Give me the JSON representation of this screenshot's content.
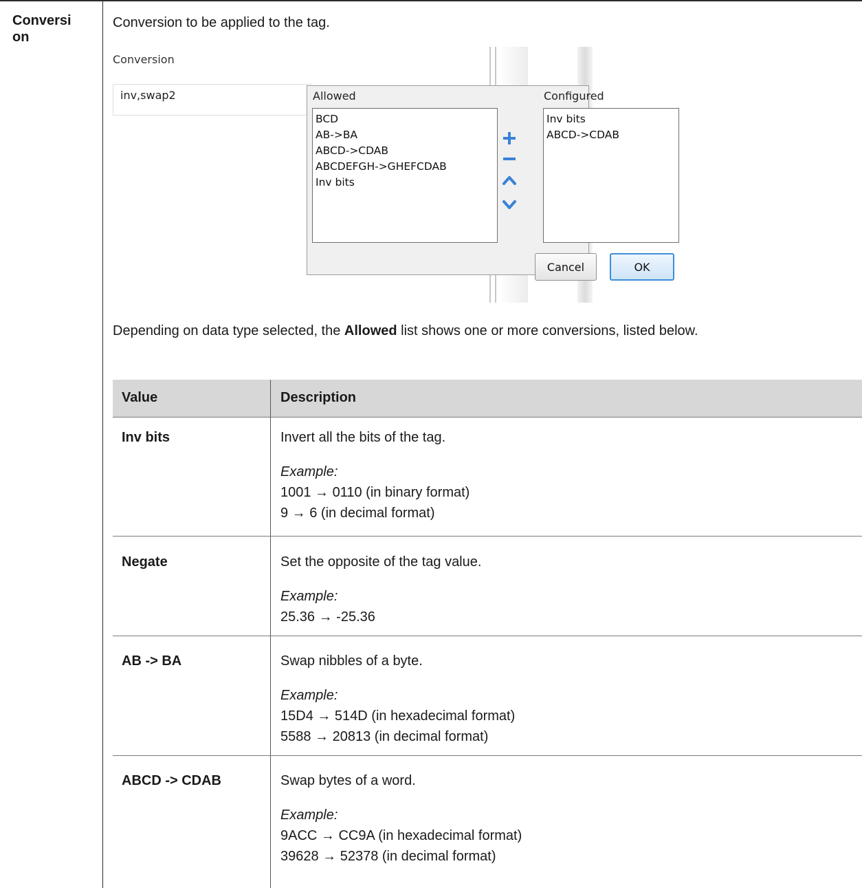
{
  "term": "Conversion",
  "term_line1": "Conversi",
  "term_line2": "on",
  "intro": "Conversion to be applied to the tag.",
  "screenshot": {
    "field_label": "Conversion",
    "field_value": "inv,swap2",
    "allowed_title": "Allowed",
    "configured_title": "Configured",
    "allowed_items": [
      "BCD",
      "AB->BA",
      "ABCD->CDAB",
      "ABCDEFGH->GHEFCDAB",
      "Inv bits"
    ],
    "configured_items": [
      "Inv bits",
      "ABCD->CDAB"
    ],
    "add_icon": "plus-icon",
    "remove_icon": "minus-icon",
    "up_icon": "chevron-up-icon",
    "down_icon": "chevron-down-icon",
    "cancel_label": "Cancel",
    "ok_label": "OK",
    "accent_color": "#3a82d6"
  },
  "paragraph": {
    "before": "Depending on data type selected, the ",
    "bold": "Allowed",
    "after": " list shows one or more conversions, listed below."
  },
  "table": {
    "headers": [
      "Value",
      "Description"
    ],
    "rows": [
      {
        "value": "Inv bits",
        "description": "Invert all the bits of the tag.",
        "example_label": "Example:",
        "examples": [
          "1001 → 0110 (in binary format)",
          "9 → 6 (in decimal format)"
        ]
      },
      {
        "value": "Negate",
        "description": "Set the opposite of the tag value.",
        "example_label": "Example:",
        "examples": [
          "25.36 → -25.36"
        ]
      },
      {
        "value": "AB -> BA",
        "description": "Swap nibbles of a byte.",
        "example_label": "Example:",
        "examples": [
          "15D4 → 514D (in hexadecimal format)",
          "5588 → 20813 (in decimal format)"
        ]
      },
      {
        "value": "ABCD -> CDAB",
        "description": "Swap bytes of a word.",
        "example_label": "Example:",
        "examples": [
          "9ACC → CC9A (in hexadecimal format)",
          "39628 → 52378 (in decimal format)"
        ]
      }
    ]
  }
}
